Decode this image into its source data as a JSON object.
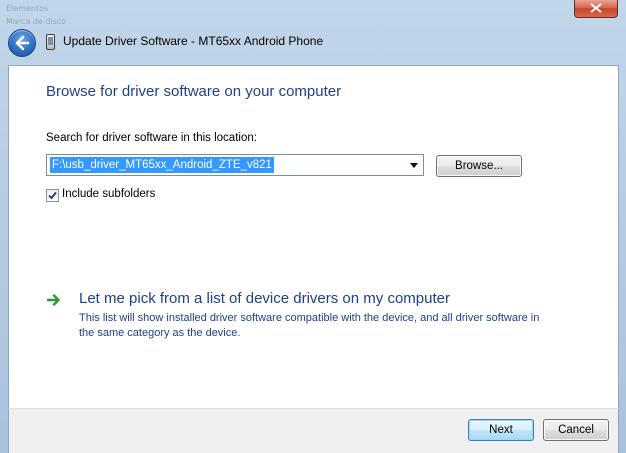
{
  "window": {
    "title": "Update Driver Software - MT65xx Android Phone"
  },
  "background": {
    "ghost_line_1": "Elementos",
    "ghost_line_2": "Marca de disco"
  },
  "content": {
    "heading": "Browse for driver software on your computer",
    "search_label": "Search for driver software in this location:",
    "path_value": "F:\\usb_driver_MT65xx_Android_ZTE_v821",
    "browse_label": "Browse...",
    "include_subfolders_label": "Include subfolders",
    "include_subfolders_checked": true,
    "pick_title": "Let me pick from a list of device drivers on my computer",
    "pick_description": "This list will show installed driver software compatible with the device, and all driver software in the same category as the device."
  },
  "footer": {
    "next_label": "Next",
    "cancel_label": "Cancel"
  },
  "colors": {
    "heading": "#1e3f8c",
    "selection": "#3399ff",
    "arrow_green": "#2e9a2e"
  },
  "icons": {
    "back": "back-arrow-icon",
    "title": "phone-device-icon",
    "close": "close-icon",
    "dropdown": "chevron-down-icon",
    "check": "checkmark-icon",
    "pick": "green-arrow-icon"
  }
}
